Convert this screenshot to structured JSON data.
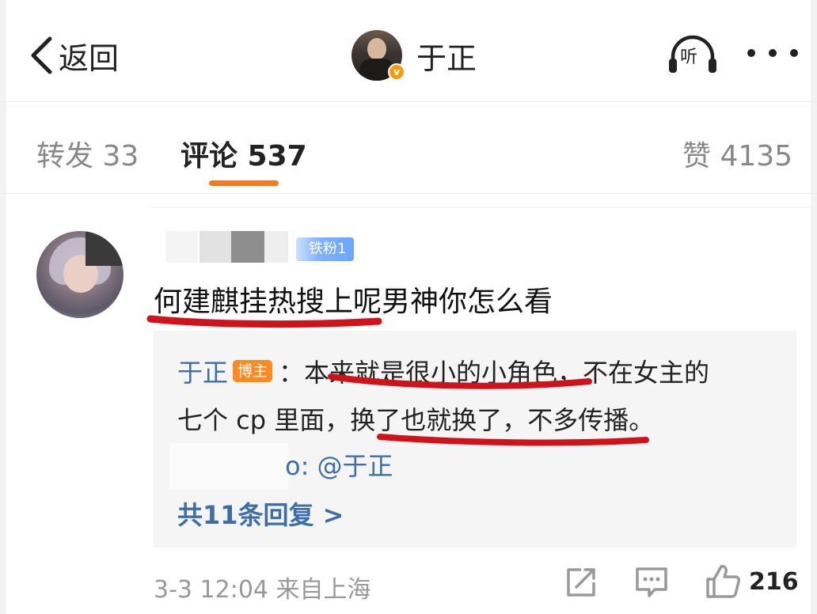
{
  "header": {
    "back_label": "返回",
    "title": "于正",
    "listen_label": "听",
    "verified_mark": "v"
  },
  "tabs": {
    "reposts": "转发 33",
    "comments": "评论 537",
    "likes": "赞 4135",
    "active": "comments",
    "accent_color": "#f47a20"
  },
  "comment": {
    "fan_badge": "铁粉1",
    "text": "何建麒挂热搜上呢男神你怎么看",
    "reply": {
      "author": "于正",
      "author_badge": "博主",
      "text_line1": "：本来就是很小的小角色，不在女主的",
      "text_line2": "七个 cp 里面，换了也就换了，不多传播。",
      "mention_text": "o: @于正",
      "more_replies": "共11条回复 >"
    },
    "meta": "3-3 12:04  来自上海",
    "like_count": "216"
  },
  "icons": {
    "back": "chevron-left-icon",
    "listen": "headphones-icon",
    "more": "more-dots-icon",
    "share": "share-icon",
    "reply": "comment-icon",
    "like": "thumbs-up-icon"
  },
  "colors": {
    "link_blue": "#3d6ea8",
    "badge_orange": "#ff8a1f",
    "annotation_red": "#d0121b"
  }
}
